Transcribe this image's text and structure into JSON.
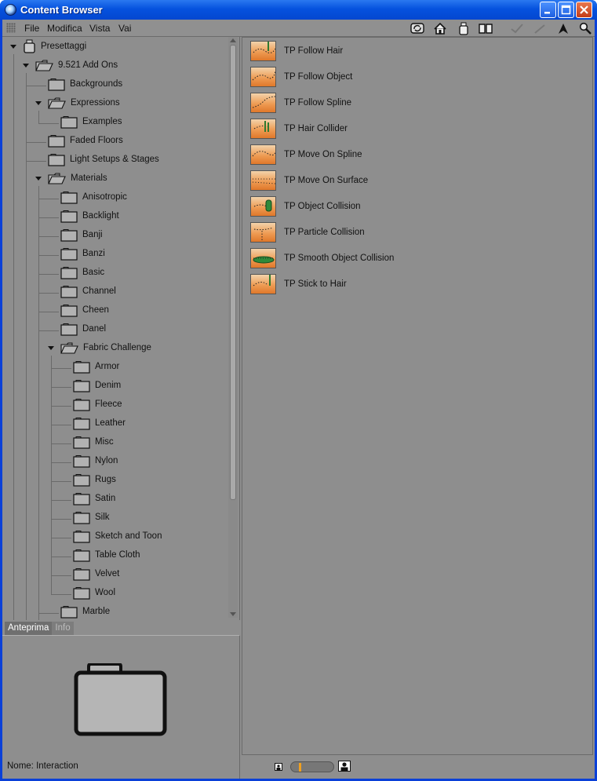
{
  "window": {
    "title": "Content Browser",
    "controls": [
      "minimize",
      "maximize",
      "close"
    ]
  },
  "menubar": {
    "items": [
      "File",
      "Modifica",
      "Vista",
      "Vai"
    ]
  },
  "toolbar": {
    "icons": [
      "refresh-icon",
      "home-icon",
      "presets-icon",
      "catalog-icon",
      "checkmark-icon",
      "wand-icon",
      "cursor-icon",
      "search-icon"
    ]
  },
  "tree": {
    "nodes": [
      {
        "label": "Presettaggi",
        "level": 0,
        "type": "presets",
        "expanded": true
      },
      {
        "label": "9.521 Add Ons",
        "level": 1,
        "type": "folder-open",
        "expanded": true
      },
      {
        "label": "Backgrounds",
        "level": 2,
        "type": "folder"
      },
      {
        "label": "Expressions",
        "level": 2,
        "type": "folder-open",
        "expanded": true
      },
      {
        "label": "Examples",
        "level": 3,
        "type": "folder"
      },
      {
        "label": "Faded Floors",
        "level": 2,
        "type": "folder"
      },
      {
        "label": "Light Setups & Stages",
        "level": 2,
        "type": "folder"
      },
      {
        "label": "Materials",
        "level": 2,
        "type": "folder-open",
        "expanded": true
      },
      {
        "label": "Anisotropic",
        "level": 3,
        "type": "folder"
      },
      {
        "label": "Backlight",
        "level": 3,
        "type": "folder"
      },
      {
        "label": "Banji",
        "level": 3,
        "type": "folder"
      },
      {
        "label": "Banzi",
        "level": 3,
        "type": "folder"
      },
      {
        "label": "Basic",
        "level": 3,
        "type": "folder"
      },
      {
        "label": "Channel",
        "level": 3,
        "type": "folder"
      },
      {
        "label": "Cheen",
        "level": 3,
        "type": "folder"
      },
      {
        "label": "Danel",
        "level": 3,
        "type": "folder"
      },
      {
        "label": "Fabric Challenge",
        "level": 3,
        "type": "folder-open",
        "expanded": true
      },
      {
        "label": "Armor",
        "level": 4,
        "type": "folder"
      },
      {
        "label": "Denim",
        "level": 4,
        "type": "folder"
      },
      {
        "label": "Fleece",
        "level": 4,
        "type": "folder"
      },
      {
        "label": "Leather",
        "level": 4,
        "type": "folder"
      },
      {
        "label": "Misc",
        "level": 4,
        "type": "folder"
      },
      {
        "label": "Nylon",
        "level": 4,
        "type": "folder"
      },
      {
        "label": "Rugs",
        "level": 4,
        "type": "folder"
      },
      {
        "label": "Satin",
        "level": 4,
        "type": "folder"
      },
      {
        "label": "Silk",
        "level": 4,
        "type": "folder"
      },
      {
        "label": "Sketch and Toon",
        "level": 4,
        "type": "folder"
      },
      {
        "label": "Table Cloth",
        "level": 4,
        "type": "folder"
      },
      {
        "label": "Velvet",
        "level": 4,
        "type": "folder"
      },
      {
        "label": "Wool",
        "level": 4,
        "type": "folder"
      },
      {
        "label": "Marble",
        "level": 3,
        "type": "folder"
      }
    ]
  },
  "preview": {
    "tabs": [
      {
        "label": "Anteprima",
        "active": true
      },
      {
        "label": "Info",
        "active": false
      }
    ],
    "name_label": "Nome:",
    "name_value": "Interaction",
    "icon": "folder-large-icon"
  },
  "content": {
    "items": [
      {
        "label": "TP Follow Hair"
      },
      {
        "label": "TP Follow Object"
      },
      {
        "label": "TP Follow Spline"
      },
      {
        "label": "TP Hair Collider"
      },
      {
        "label": "TP Move On Spline"
      },
      {
        "label": "TP Move On Surface"
      },
      {
        "label": "TP Object Collision"
      },
      {
        "label": "TP Particle Collision"
      },
      {
        "label": "TP Smooth Object Collision"
      },
      {
        "label": "TP Stick to Hair"
      }
    ]
  },
  "statusbar": {
    "zoom_icons": [
      "small-thumbnail-icon",
      "large-thumbnail-icon"
    ],
    "zoom_level": 0.15
  },
  "colors": {
    "titlebar": "#0552de",
    "panel": "#8e8e8e",
    "thumbnail_orange": "#ee9c54"
  }
}
